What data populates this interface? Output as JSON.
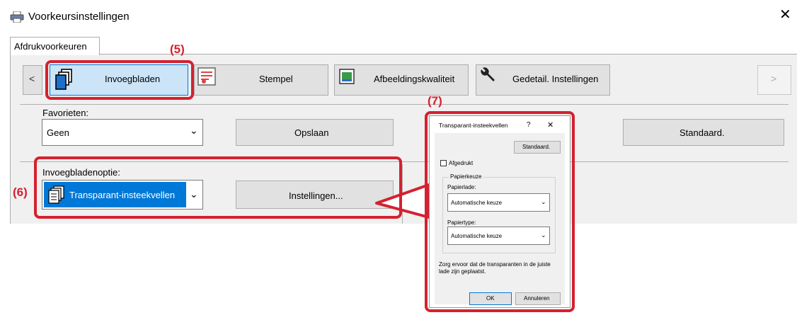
{
  "window": {
    "title": "Voorkeursinstellingen",
    "close_glyph": "✕"
  },
  "tab": {
    "label": "Afdrukvoorkeuren"
  },
  "toolbar": {
    "nav_prev": "<",
    "nav_next": ">",
    "buttons": [
      {
        "label": "Invoegbladen",
        "icon": "pages-icon",
        "selected": true
      },
      {
        "label": "Stempel",
        "icon": "stamp-icon"
      },
      {
        "label": "Afbeeldingskwaliteit",
        "icon": "image-quality-icon"
      },
      {
        "label": "Gedetail. Instellingen",
        "icon": "wrench-icon"
      }
    ]
  },
  "favorites": {
    "label": "Favorieten:",
    "value": "Geen",
    "save_label": "Opslaan",
    "default_label": "Standaard."
  },
  "insert_option": {
    "label": "Invoegbladenoptie:",
    "value": "Transparant-insteekvellen",
    "settings_label": "Instellingen..."
  },
  "annotations": {
    "a5": "(5)",
    "a6": "(6)",
    "a7": "(7)"
  },
  "dialog": {
    "title": "Transparant-insteekvellen",
    "help": "?",
    "close": "✕",
    "default_label": "Standaard.",
    "printed_label": "Afgedrukt",
    "group_label": "Papierkeuze",
    "tray_label": "Papierlade:",
    "tray_value": "Automatische keuze",
    "type_label": "Papiertype:",
    "type_value": "Automatische keuze",
    "note": "Zorg ervoor dat de transparanten in de juiste lade zijn geplaatst.",
    "ok_label": "OK",
    "cancel_label": "Annuleren"
  },
  "colors": {
    "accent": "#0078d7",
    "annotation": "#d4212f",
    "selected_bg": "#cce4f7"
  }
}
